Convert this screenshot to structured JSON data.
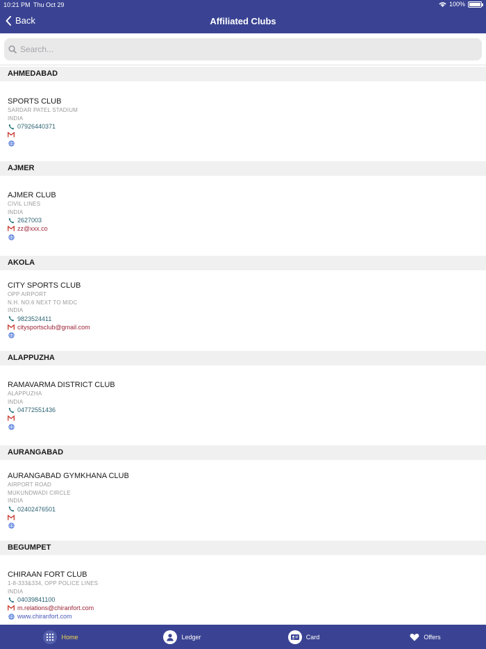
{
  "status_bar": {
    "time": "10:21 PM",
    "date": "Thu Oct 29",
    "battery": "100%"
  },
  "nav": {
    "back_label": "Back",
    "title": "Affiliated Clubs"
  },
  "search": {
    "placeholder": "Search..."
  },
  "sections": [
    {
      "header": "AHMEDABAD",
      "club": {
        "name": "SPORTS CLUB",
        "address": [
          "SARDAR PATEL STADIUM",
          "INDIA"
        ],
        "phone": "07926440371",
        "email": "",
        "website": ""
      }
    },
    {
      "header": "AJMER",
      "club": {
        "name": "AJMER CLUB",
        "address": [
          "CIVIL LINES",
          "INDIA"
        ],
        "phone": "2627003",
        "email": "zz@xxx.co",
        "website": ""
      }
    },
    {
      "header": "AKOLA",
      "club": {
        "name": "CITY SPORTS CLUB",
        "address": [
          "OPP AIRPORT",
          "N.H. NO.6 NEXT TO MIDC",
          "INDIA"
        ],
        "phone": "9823524411",
        "email": "citysportsclub@gmail.com",
        "website": ""
      }
    },
    {
      "header": "ALAPPUZHA",
      "club": {
        "name": "RAMAVARMA DISTRICT CLUB",
        "address": [
          "ALAPPUZHA",
          "INDIA"
        ],
        "phone": "04772551436",
        "email": "",
        "website": ""
      }
    },
    {
      "header": "AURANGABAD",
      "club": {
        "name": "AURANGABAD GYMKHANA CLUB",
        "address": [
          "AIRPORT ROAD",
          "MUKUNDWADI CIRCLE",
          "INDIA"
        ],
        "phone": "02402476501",
        "email": "",
        "website": ""
      }
    },
    {
      "header": "BEGUMPET",
      "club": {
        "name": "CHIRAAN FORT CLUB",
        "address": [
          "1-8-333&334, OPP POLICE LINES",
          "INDIA"
        ],
        "phone": "04039841100",
        "email": "m.relations@chiranfort.com",
        "website": "www.chiranfort.com"
      }
    }
  ],
  "tabs": [
    {
      "label": "Home",
      "icon": "grid-icon",
      "active": true
    },
    {
      "label": "Ledger",
      "icon": "person-icon",
      "active": false
    },
    {
      "label": "Card",
      "icon": "id-card-icon",
      "active": false
    },
    {
      "label": "Offers",
      "icon": "heart-icon",
      "active": false
    }
  ],
  "colors": {
    "nav_bg": "#3a4393",
    "active_tab": "#f2d74e",
    "phone": "#2b6272",
    "email": "#9b2335",
    "web": "#4a59b8"
  }
}
